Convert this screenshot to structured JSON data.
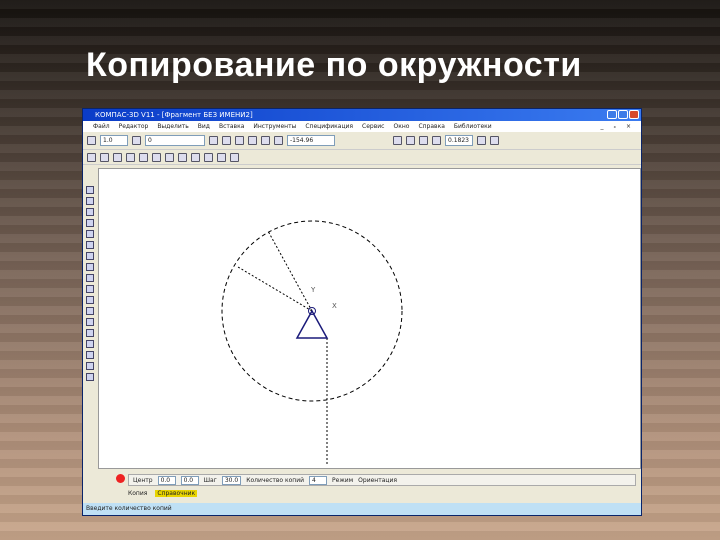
{
  "slide": {
    "title": "Копирование по окружности"
  },
  "window": {
    "title": "КОМПАС-3D V11 - [Фрагмент БЕЗ ИМЕНИ2]"
  },
  "menu": [
    "Файл",
    "Редактор",
    "Выделить",
    "Вид",
    "Вставка",
    "Инструменты",
    "Спецификация",
    "Сервис",
    "Окно",
    "Справка",
    "Библиотеки"
  ],
  "mdi_controls": "_ ₓ ×",
  "toolbar1": {
    "style_value": "1.0",
    "layer_value": "0",
    "coords_value": "-154.96",
    "zoom_value": "0.1823"
  },
  "panel": {
    "center_label": "Центр",
    "center_x": "0.0",
    "center_y": "0.0",
    "step_label": "Шаг",
    "step_value": "30.0",
    "count_label": "Количество копий",
    "count_value": "4",
    "mode_label": "Режим",
    "orient_label": "Ориентация",
    "tab_copy": "Копия",
    "tab_help": "Справочник"
  },
  "drawing": {
    "axis_x": "X",
    "axis_y": "Y"
  },
  "status": "Введите количество копий"
}
